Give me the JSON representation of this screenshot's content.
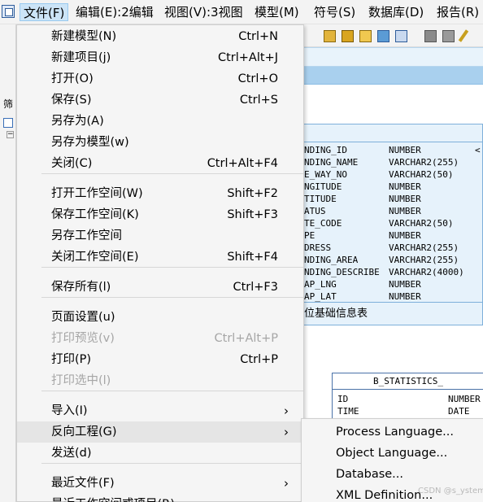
{
  "menubar": {
    "items": [
      "文件(F)",
      "编辑(E):2编辑",
      "视图(V):3视图",
      "模型(M)",
      "符号(S)",
      "数据库(D)",
      "报告(R)"
    ]
  },
  "left_panel": {
    "filter_label": "筛"
  },
  "file_menu": {
    "groups": [
      [
        {
          "label": "新建模型(N)",
          "shortcut": "Ctrl+N"
        },
        {
          "label": "新建项目(j)",
          "shortcut": "Ctrl+Alt+J"
        },
        {
          "label": "打开(O)",
          "shortcut": "Ctrl+O"
        },
        {
          "label": "保存(S)",
          "shortcut": "Ctrl+S"
        },
        {
          "label": "另存为(A)",
          "shortcut": ""
        },
        {
          "label": "另存为模型(w)",
          "shortcut": ""
        },
        {
          "label": "关闭(C)",
          "shortcut": "Ctrl+Alt+F4"
        }
      ],
      [
        {
          "label": "打开工作空间(W)",
          "shortcut": "Shift+F2"
        },
        {
          "label": "保存工作空间(K)",
          "shortcut": "Shift+F3"
        },
        {
          "label": "另存工作空间",
          "shortcut": ""
        },
        {
          "label": "关闭工作空间(E)",
          "shortcut": "Shift+F4"
        }
      ],
      [
        {
          "label": "保存所有(l)",
          "shortcut": "Ctrl+F3"
        }
      ],
      [
        {
          "label": "页面设置(u)",
          "shortcut": ""
        },
        {
          "label": "打印预览(v)",
          "shortcut": "Ctrl+Alt+P",
          "disabled": true
        },
        {
          "label": "打印(P)",
          "shortcut": "Ctrl+P"
        },
        {
          "label": "打印选中(l)",
          "shortcut": "",
          "disabled": true
        }
      ],
      [
        {
          "label": "导入(I)",
          "shortcut": "",
          "submenu": true
        },
        {
          "label": "反向工程(G)",
          "shortcut": "",
          "submenu": true,
          "highlighted": true
        },
        {
          "label": "发送(d)",
          "shortcut": ""
        }
      ],
      [
        {
          "label": "最近文件(F)",
          "shortcut": "",
          "submenu": true
        },
        {
          "label": "最近工作空间或项目(R)",
          "shortcut": "",
          "submenu": true
        }
      ]
    ]
  },
  "submenu": {
    "items": [
      "Process Language...",
      "Object Language...",
      "Database...",
      "XML Definition..."
    ]
  },
  "table1": {
    "rows": [
      [
        "NDING_ID",
        "NUMBER"
      ],
      [
        "NDING_NAME",
        "VARCHAR2(255)"
      ],
      [
        "E_WAY_NO",
        "VARCHAR2(50)"
      ],
      [
        "NGITUDE",
        "NUMBER"
      ],
      [
        "TITUDE",
        "NUMBER"
      ],
      [
        "ATUS",
        "NUMBER"
      ],
      [
        "TE_CODE",
        "VARCHAR2(50)"
      ],
      [
        "PE",
        "NUMBER"
      ],
      [
        "DRESS",
        "VARCHAR2(255)"
      ],
      [
        "NDING_AREA",
        "VARCHAR2(255)"
      ],
      [
        "NDING_DESCRIBE",
        "VARCHAR2(4000)"
      ],
      [
        "AP_LNG",
        "NUMBER"
      ],
      [
        "AP_LAT",
        "NUMBER"
      ]
    ],
    "pk_marker": "<",
    "footer": "位基础信息表"
  },
  "table2": {
    "title": "B_STATISTICS_",
    "rows": [
      [
        "ID",
        "NUMBER"
      ],
      [
        "TIME",
        "DATE"
      ]
    ]
  },
  "watermark": "CSDN @s_ystem",
  "colors": {
    "menu_bg": "#f5f5f5",
    "menu_highlight": "#e5e5e5",
    "disabled_text": "#a6a6a6",
    "table_fill": "#e6f2fb",
    "table_border": "#7eb0da"
  }
}
